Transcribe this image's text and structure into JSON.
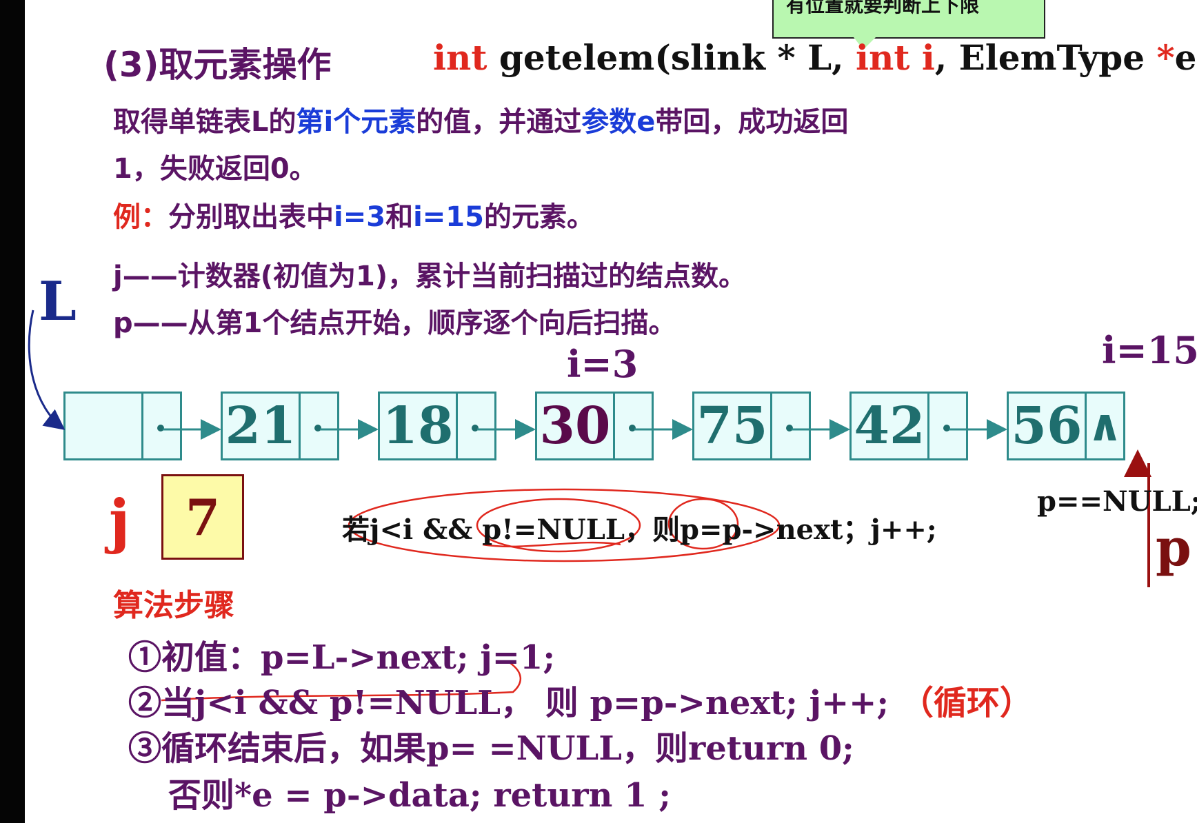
{
  "callout": {
    "text": "有位置就要判断上下限"
  },
  "title": {
    "label": "(3)取元素操作",
    "sig_int1": "int",
    "sig_part1": " getelem(slink * L, ",
    "sig_int2": "int",
    "sig_i": " i",
    "sig_part2": ", ElemType ",
    "sig_star": "*",
    "sig_part3": "e);"
  },
  "description": {
    "line1_a": "取得单链表L的",
    "line1_b": "第i个元素",
    "line1_c": "的值，并通过",
    "line1_d": "参数e",
    "line1_e": "带回，成功返回",
    "line2": "1，失败返回0。"
  },
  "example": {
    "label": "例：",
    "text_a": "分别取出表中",
    "i3": "i=3",
    "and": "和",
    "i15": "i=15",
    "text_b": "的元素。"
  },
  "vars": {
    "j_line": "j——计数器(初值为1)，累计当前扫描过的结点数。",
    "p_line": "p——从第1个结点开始，顺序逐个向后扫描。"
  },
  "list": {
    "head_label": "L",
    "i3_label": "i=3",
    "i15_label": "i=15",
    "nodes": [
      "",
      "21",
      "18",
      "30",
      "75",
      "42",
      "56"
    ],
    "null_symbol": "∧"
  },
  "counter": {
    "label": "j",
    "value": "7"
  },
  "condition": "若j<i && p!=NULL，则p=p->next；j++;",
  "pointer": {
    "label": "p",
    "null_check": "p==NULL;"
  },
  "algorithm": {
    "heading": "算法步骤",
    "step1": "①初值：p=L->next; j=1;",
    "step2_a": "②当j<i && p!=NULL，",
    "step2_b": "则 p=p->next; j++;",
    "step2_c": "（循环）",
    "step3": "③循环结束后，如果p= =NULL，则return 0;",
    "step3_b": "否则*e = p->data; return 1 ;"
  },
  "colors": {
    "node_border": "#2e8b8b",
    "node_fill": "#e8fcfb",
    "title": "#5a1464",
    "accent_red": "#e0281e",
    "accent_blue": "#1a3cd8",
    "counter_fill": "#fdfaa8"
  }
}
